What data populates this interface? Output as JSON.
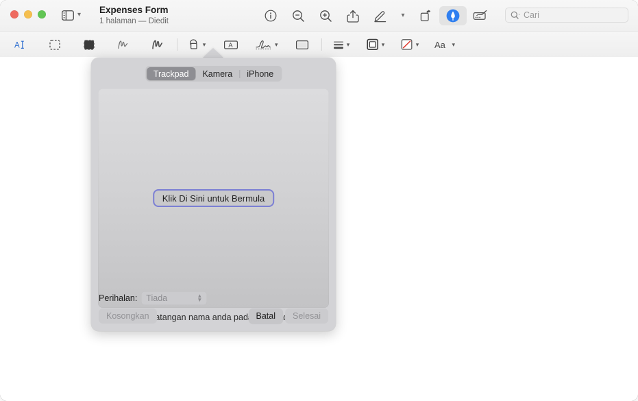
{
  "window": {
    "traffic_lights": [
      {
        "name": "close",
        "color": "#ee6a5f"
      },
      {
        "name": "minimize",
        "color": "#f5bf4f"
      },
      {
        "name": "maximize",
        "color": "#61c554"
      }
    ]
  },
  "titlebar": {
    "document_title": "Expenses Form",
    "document_subtitle": "1 halaman — Diedit",
    "sidebar_toggle_icon": "sidebar-icon",
    "sidebar_toggle_chevron": "chevron-down-icon",
    "tools": [
      {
        "name": "info-icon",
        "label": "Maklumat"
      },
      {
        "name": "zoom-out-icon",
        "label": "Zum Keluar"
      },
      {
        "name": "zoom-in-icon",
        "label": "Zum Masuk"
      },
      {
        "name": "share-icon",
        "label": "Kongsi"
      },
      {
        "name": "markup-pen-icon",
        "label": "Tunjuk Bar Alat Penandaan"
      },
      {
        "name": "chevron-down-icon",
        "label": "Lagi"
      },
      {
        "name": "rotate-icon",
        "label": "Putar"
      },
      {
        "name": "highlight-icon",
        "label": "Sorot",
        "active": true
      },
      {
        "name": "signature-tool-icon",
        "label": "Tandatangan"
      }
    ],
    "search": {
      "icon": "search-icon",
      "chevron": "chevron-down-icon",
      "placeholder": "Cari",
      "value": ""
    }
  },
  "markup_toolbar": {
    "tools": [
      {
        "name": "text-selection-icon",
        "label": "Pilihan Teks",
        "accent": "#2f6fd0"
      },
      {
        "name": "rectangular-selection-icon",
        "label": "Pilihan Segi Empat"
      },
      {
        "name": "instant-alpha-icon",
        "label": "Alfa Segera"
      },
      {
        "name": "sketch-icon",
        "label": "Lakar"
      },
      {
        "name": "draw-icon",
        "label": "Lukis"
      },
      {
        "name": "shapes-icon",
        "label": "Bentuk",
        "chevron": true
      },
      {
        "name": "text-box-icon",
        "label": "Teks"
      },
      {
        "name": "signature-icon",
        "label": "Tandatangan",
        "chevron": true,
        "active": true
      },
      {
        "name": "note-icon",
        "label": "Nota"
      },
      {
        "name": "shape-style-icon",
        "label": "Gaya Bentuk",
        "chevron": true
      },
      {
        "name": "border-color-icon",
        "label": "Warna Sempadan",
        "chevron": true
      },
      {
        "name": "fill-color-icon",
        "label": "Warna Isian",
        "chevron": true
      },
      {
        "name": "font-style-icon",
        "label": "Aa",
        "chevron": true
      }
    ]
  },
  "popover": {
    "tabs": [
      {
        "id": "trackpad",
        "label": "Trackpad",
        "selected": true
      },
      {
        "id": "kamera",
        "label": "Kamera",
        "selected": false
      },
      {
        "id": "iphone",
        "label": "iPhone",
        "selected": false
      }
    ],
    "start_button_label": "Klik Di Sini untuk Bermula",
    "hint_text": "Tandatangan nama anda pada trackpad.",
    "description": {
      "label": "Perihalan:",
      "value": "Tiada",
      "stepper_icon": "stepper-updown-icon"
    },
    "buttons": {
      "clear": "Kosongkan",
      "cancel": "Batal",
      "done": "Selesai"
    },
    "accent_color": "#7b7fd4",
    "background_color": "#d3d3d6"
  }
}
